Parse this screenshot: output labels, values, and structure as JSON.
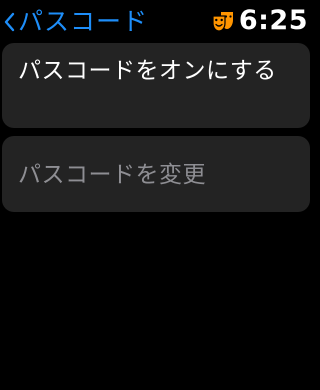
{
  "theme": {
    "accent": "#1e8ef9",
    "icon_color": "#ff9500"
  },
  "header": {
    "back_label": "パスコード",
    "back_icon": "chevron-left-icon",
    "status_icon": "theater-masks-icon",
    "time": "6:25"
  },
  "list": {
    "items": [
      {
        "label": "パスコードをオンにする",
        "enabled": true
      },
      {
        "label": "パスコードを変更",
        "enabled": false
      }
    ]
  }
}
